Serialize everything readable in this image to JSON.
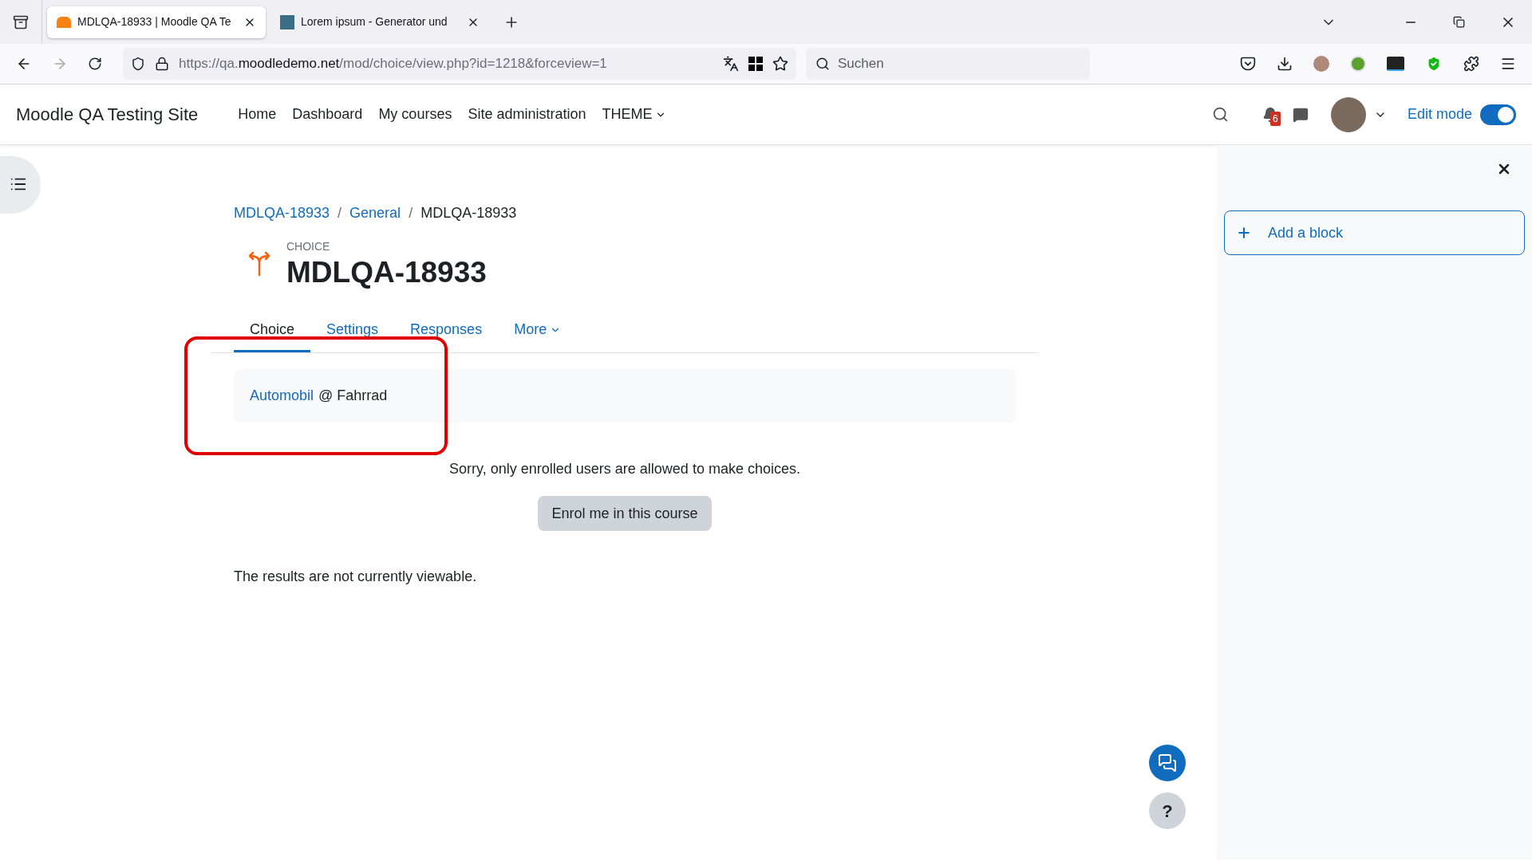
{
  "browser": {
    "tabs": [
      {
        "title": "MDLQA-18933 | Moodle QA Te",
        "selected": true
      },
      {
        "title": "Lorem ipsum - Generator und",
        "selected": false
      }
    ],
    "url": {
      "host_prefix": "https://qa.",
      "host": "moodledemo.net",
      "path": "/mod/choice/view.php?id=1218&forceview=1"
    },
    "search": {
      "placeholder": "Suchen"
    }
  },
  "navbar": {
    "site_name": "Moodle QA Testing Site",
    "items": [
      {
        "label": "Home",
        "dropdown": false
      },
      {
        "label": "Dashboard",
        "dropdown": false
      },
      {
        "label": "My courses",
        "dropdown": false
      },
      {
        "label": "Site administration",
        "dropdown": false
      },
      {
        "label": "THEME",
        "dropdown": true
      }
    ],
    "notification_count": "6",
    "edit_mode": {
      "label": "Edit mode",
      "on": true
    }
  },
  "breadcrumb": [
    {
      "label": "MDLQA-18933",
      "link": true
    },
    {
      "separator": "/"
    },
    {
      "label": "General",
      "link": true
    },
    {
      "separator": "/"
    },
    {
      "label": "MDLQA-18933",
      "link": false
    }
  ],
  "activity": {
    "type_label": "CHOICE",
    "title": "MDLQA-18933"
  },
  "secondary_tabs": [
    {
      "label": "Choice",
      "selected": true,
      "dropdown": false
    },
    {
      "label": "Settings",
      "selected": false,
      "dropdown": false
    },
    {
      "label": "Responses",
      "selected": false,
      "dropdown": false
    },
    {
      "label": "More",
      "selected": false,
      "dropdown": true
    }
  ],
  "choice_option": {
    "link": "Automobil",
    "rest": "@ Fahrrad"
  },
  "message": "Sorry, only enrolled users are allowed to make choices.",
  "enrol_button": "Enrol me in this course",
  "results_note": "The results are not currently viewable.",
  "drawer": {
    "add_block": "Add a block"
  },
  "help_button": "?"
}
